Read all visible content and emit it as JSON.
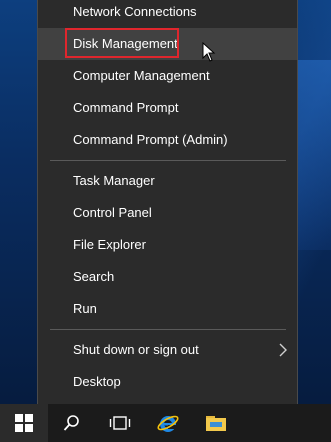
{
  "menu": {
    "items": [
      {
        "label": "Network Connections"
      },
      {
        "label": "Disk Management"
      },
      {
        "label": "Computer Management"
      },
      {
        "label": "Command Prompt"
      },
      {
        "label": "Command Prompt (Admin)"
      },
      {
        "label": "Task Manager"
      },
      {
        "label": "Control Panel"
      },
      {
        "label": "File Explorer"
      },
      {
        "label": "Search"
      },
      {
        "label": "Run"
      },
      {
        "label": "Shut down or sign out",
        "submenu": true
      },
      {
        "label": "Desktop"
      }
    ],
    "highlighted_item": "Disk Management",
    "highlight_color": "#e0262d"
  },
  "taskbar": {
    "buttons": [
      "windows-start-icon",
      "search-icon",
      "task-view-icon",
      "internet-explorer-icon",
      "file-explorer-icon"
    ]
  }
}
